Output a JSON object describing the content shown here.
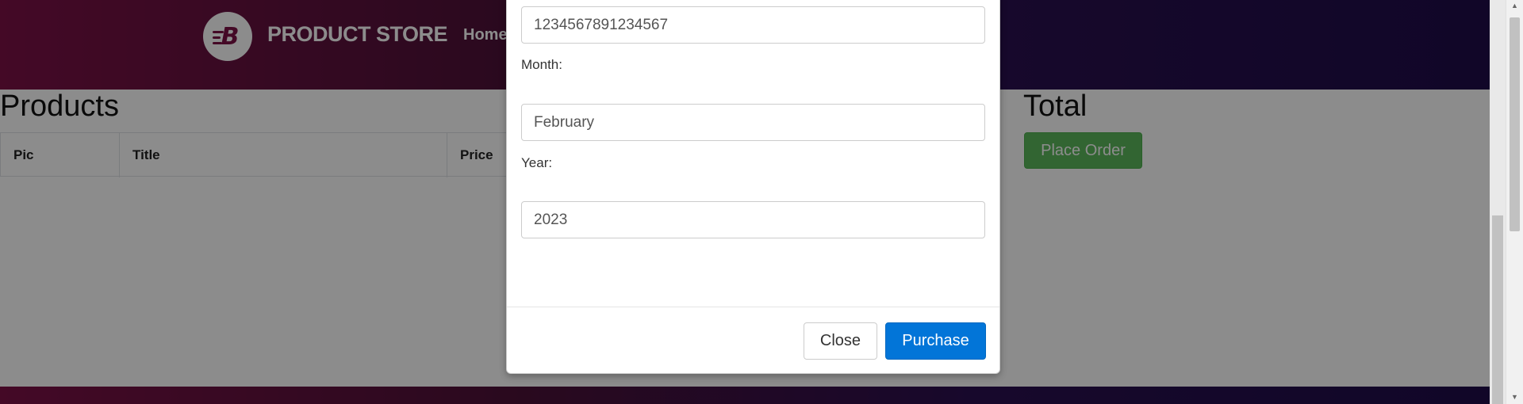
{
  "navbar": {
    "brand": "PRODUCT STORE",
    "brand_logo_letter": "B",
    "home_link": "Home"
  },
  "cart": {
    "products_heading": "Products",
    "table_headers": [
      "Pic",
      "Title",
      "Price"
    ],
    "total_heading": "Total",
    "place_order_label": "Place Order"
  },
  "modal": {
    "card_value": "1234567891234567",
    "month_label": "Month:",
    "month_value": "February",
    "year_label": "Year:",
    "year_value": "2023",
    "close_label": "Close",
    "purchase_label": "Purchase"
  },
  "colors": {
    "purchase_button": "#0275d8",
    "place_order_button": "#5cb85c",
    "navbar_gradient_start": "#7c1146",
    "navbar_gradient_end": "#1f0c4a"
  }
}
